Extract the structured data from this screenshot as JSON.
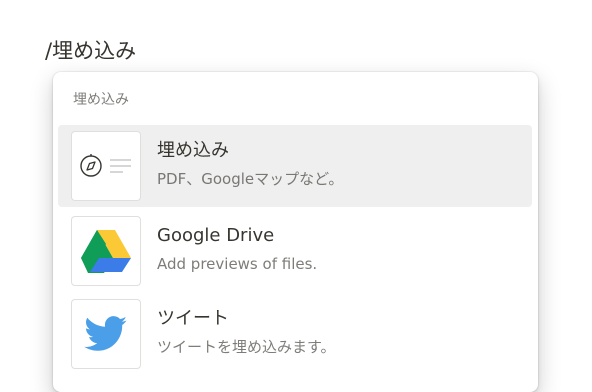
{
  "command": {
    "typed_text": "/埋め込み"
  },
  "menu": {
    "section_label": "埋め込み",
    "items": [
      {
        "title": "埋め込み",
        "description": "PDF、Googleマップなど。",
        "icon": "compass-icon",
        "selected": true
      },
      {
        "title": "Google Drive",
        "description": "Add previews of files.",
        "icon": "google-drive-icon",
        "selected": false
      },
      {
        "title": "ツイート",
        "description": "ツイートを埋め込みます。",
        "icon": "twitter-bird-icon",
        "selected": false
      }
    ]
  },
  "colors": {
    "text": "#37352f",
    "selected_row": "#ededec",
    "twitter_blue": "#4a9fe8",
    "drive_green": "#0f9d58",
    "drive_yellow": "#fbc935",
    "drive_blue": "#3b7ce8"
  }
}
